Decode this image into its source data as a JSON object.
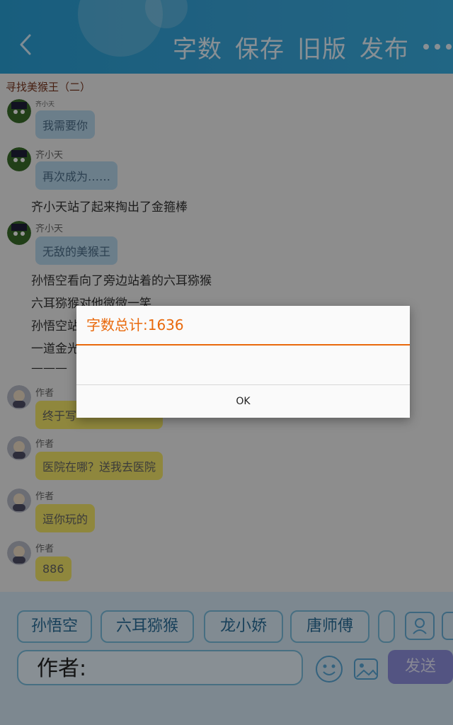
{
  "header": {
    "actions": [
      "字数",
      "保存",
      "旧版",
      "发布"
    ]
  },
  "story": {
    "title": "寻找美猴王（二）",
    "messages": [
      {
        "type": "char",
        "name": "齐小天",
        "text": "我需要你",
        "color": "blue"
      },
      {
        "type": "char",
        "name": "齐小天",
        "text": "再次成为……",
        "color": "blue"
      },
      {
        "type": "narration",
        "text": "齐小天站了起来掏出了金箍棒"
      },
      {
        "type": "char",
        "name": "齐小天",
        "text": "无敌的美猴王",
        "color": "blue"
      },
      {
        "type": "narration",
        "text": "孙悟空看向了旁边站着的六耳猕猴"
      },
      {
        "type": "narration",
        "text": "六耳猕猴对他微微一笑"
      },
      {
        "type": "narration",
        "text": "孙悟空站"
      },
      {
        "type": "narration",
        "text": "一道金光"
      },
      {
        "type": "narration",
        "text": "———"
      },
      {
        "type": "author",
        "name": "作者",
        "text": "终于写",
        "color": "yellow"
      },
      {
        "type": "author",
        "name": "作者",
        "text": "医院在哪？送我去医院",
        "color": "yellow"
      },
      {
        "type": "author",
        "name": "作者",
        "text": "逗你玩的",
        "color": "yellow"
      },
      {
        "type": "author",
        "name": "作者",
        "text": "886",
        "color": "yellow"
      }
    ]
  },
  "dialog": {
    "title": "字数总计:1636",
    "ok": "OK"
  },
  "characters": [
    "孙悟空",
    "六耳猕猴",
    "龙小娇",
    "唐师傅"
  ],
  "composer": {
    "speaker": "作者:",
    "send": "发送"
  },
  "colors": {
    "header": "#2aa2d8",
    "accent": "#e9690c",
    "send": "#8f91e1"
  }
}
